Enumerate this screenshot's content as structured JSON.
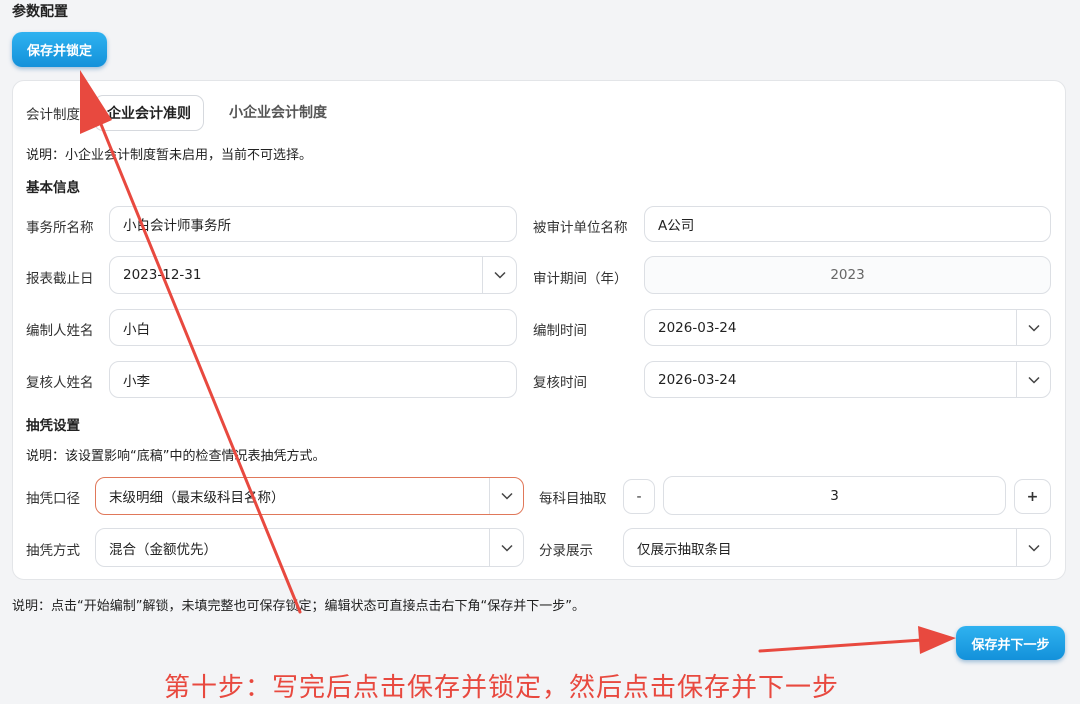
{
  "page": {
    "title": "参数配置"
  },
  "toolbar": {
    "save_lock_label": "保存并锁定"
  },
  "accounting": {
    "label": "会计制度",
    "options": [
      "企业会计准则",
      "小企业会计制度"
    ],
    "selected": "企业会计准则",
    "note": "说明：小企业会计制度暂未启用，当前不可选择。"
  },
  "basic": {
    "header": "基本信息",
    "firm_label": "事务所名称",
    "firm_value": "小白会计师事务所",
    "audited_label": "被审计单位名称",
    "audited_value": "A公司",
    "report_date_label": "报表截止日",
    "report_date_value": "2023-12-31",
    "period_label": "审计期间（年）",
    "period_value": "2023",
    "preparer_label": "编制人姓名",
    "preparer_value": "小白",
    "prep_time_label": "编制时间",
    "prep_time_value": "2026-03-24",
    "reviewer_label": "复核人姓名",
    "reviewer_value": "小李",
    "review_time_label": "复核时间",
    "review_time_value": "2026-03-24"
  },
  "sampling": {
    "header": "抽凭设置",
    "note": "说明：该设置影响“底稿”中的检查情况表抽凭方式。",
    "scope_label": "抽凭口径",
    "scope_value": "末级明细（最末级科目名称）",
    "per_subject_label": "每科目抽取",
    "per_subject_value": "3",
    "minus_label": "-",
    "plus_label": "+",
    "method_label": "抽凭方式",
    "method_value": "混合（金额优先）",
    "entry_label": "分录展示",
    "entry_value": "仅展示抽取条目"
  },
  "footer": {
    "note": "说明：点击“开始编制”解锁，未填完整也可保存锁定；编辑状态可直接点击右下角“保存并下一步”。",
    "next_label": "保存并下一步"
  },
  "annotation": {
    "text": "第十步：写完后点击保存并锁定，然后点击保存并下一步",
    "color": "#e8493f"
  },
  "colors": {
    "accent": "#1a9be3",
    "focus_border": "#e0785a"
  }
}
